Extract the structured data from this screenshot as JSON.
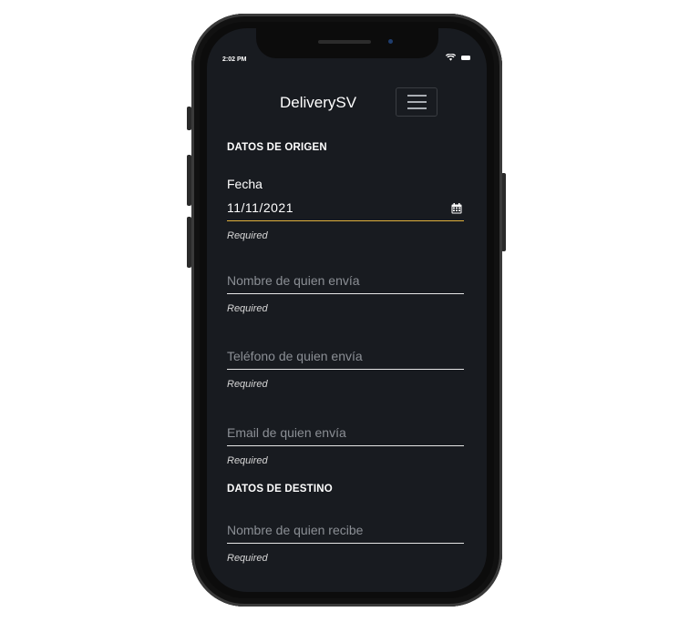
{
  "status_bar": {
    "time": "2:02 PM",
    "icons": [
      "wifi-icon",
      "battery-icon"
    ]
  },
  "navbar": {
    "title": "DeliverySV",
    "menu_icon": "hamburger-icon"
  },
  "origin_section": {
    "title": "DATOS DE ORIGEN",
    "date_field": {
      "label": "Fecha",
      "value": "11/11/2021",
      "icon": "calendar-icon",
      "hint": "Required"
    },
    "sender_name": {
      "placeholder": "Nombre de quien envía",
      "hint": "Required"
    },
    "sender_phone": {
      "placeholder": "Teléfono de quien envía",
      "hint": "Required"
    },
    "sender_email": {
      "placeholder": "Email de quien envía",
      "hint": "Required"
    }
  },
  "destination_section": {
    "title": "DATOS DE DESTINO",
    "receiver_name": {
      "placeholder": "Nombre de quien recibe",
      "hint": "Required"
    }
  },
  "colors": {
    "screen_background": "#181b20",
    "active_underline": "#e0b23c",
    "underline": "#e6e6e6",
    "placeholder": "#8b8f95"
  }
}
